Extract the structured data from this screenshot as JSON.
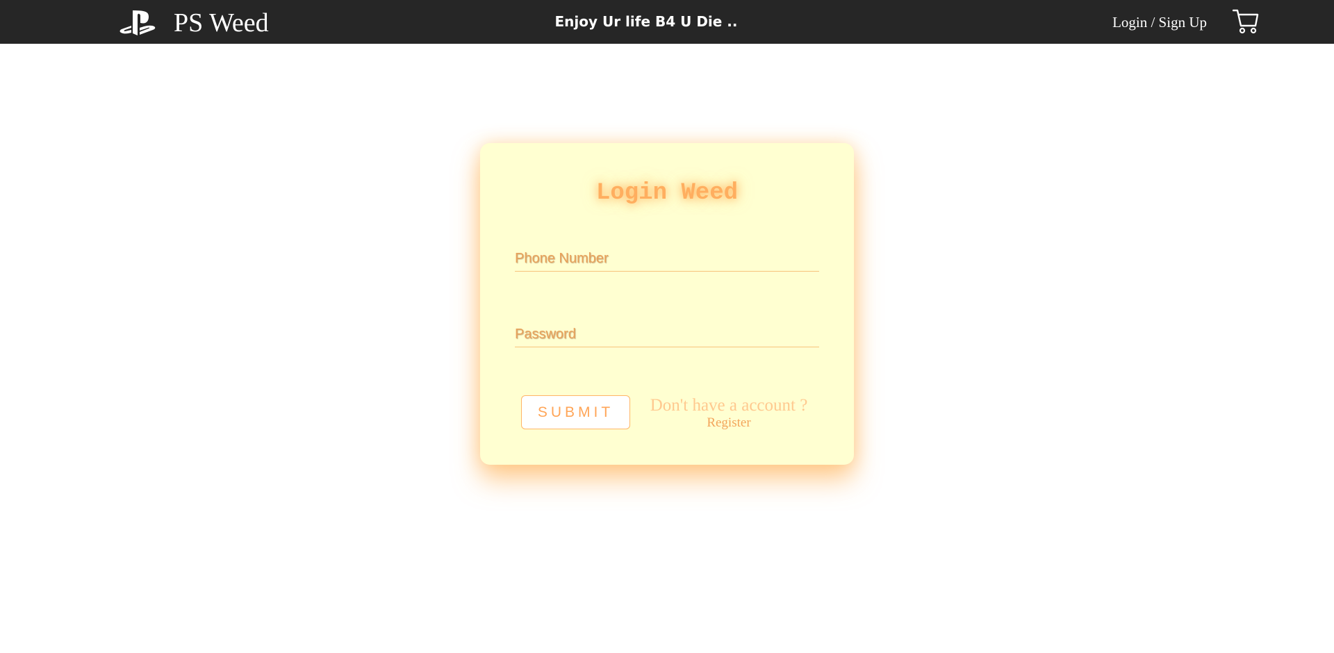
{
  "header": {
    "brand_icon": "playstation-logo-icon",
    "brand_name": "PS Weed",
    "tagline": "Enjoy Ur life B4 U Die ..",
    "login_signup_label": "Login / Sign Up",
    "cart_icon": "shopping-cart-icon"
  },
  "login_card": {
    "title": "Login Weed",
    "phone_placeholder": "Phone Number",
    "password_placeholder": "Password",
    "submit_label": "SUBMIT",
    "account_prompt": "Don't have a account ?",
    "register_label": "Register"
  },
  "colors": {
    "header_bg": "#262626",
    "card_bg": "#ffffd1",
    "accent": "#ffae5f"
  }
}
